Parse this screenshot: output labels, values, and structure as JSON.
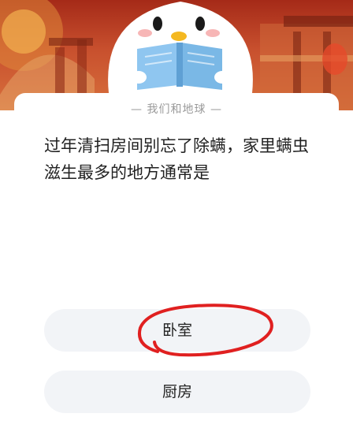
{
  "header": {
    "topic": "我们和地球"
  },
  "question": {
    "text": "过年清扫房间别忘了除螨，家里螨虫滋生最多的地方通常是"
  },
  "options": [
    {
      "label": "卧室",
      "highlighted": true
    },
    {
      "label": "厨房",
      "highlighted": false
    }
  ],
  "colors": {
    "banner": "#b93a20",
    "mascot_body": "#ffffff",
    "book": "#8fc6f0",
    "highlight_circle": "#e02020",
    "option_bg": "#f2f4f7"
  },
  "icons": [
    "mascot-penguin-icon",
    "book-icon"
  ]
}
